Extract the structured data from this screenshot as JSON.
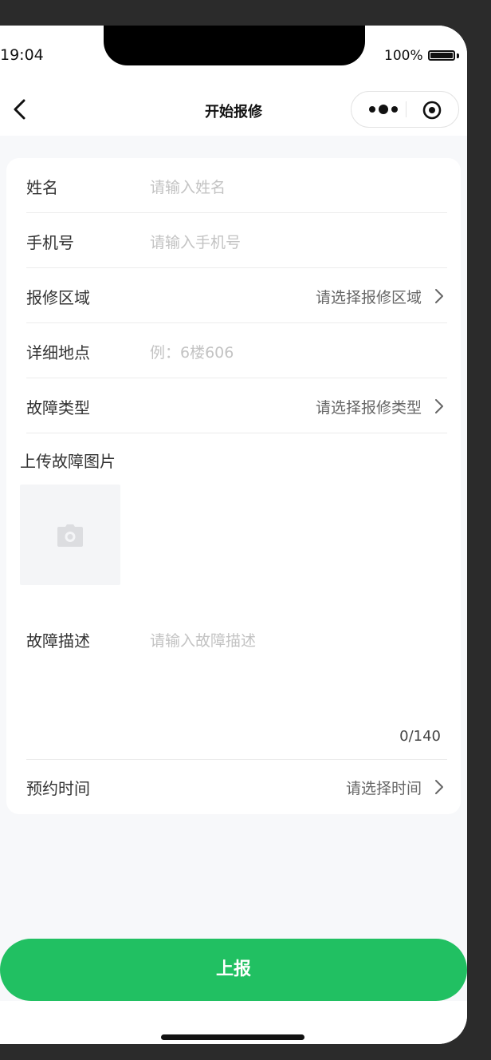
{
  "status_bar": {
    "time": "19:04",
    "battery": "100%"
  },
  "nav": {
    "title": "开始报修"
  },
  "form": {
    "name": {
      "label": "姓名",
      "placeholder": "请输入姓名"
    },
    "phone": {
      "label": "手机号",
      "placeholder": "请输入手机号"
    },
    "area": {
      "label": "报修区域",
      "value": "请选择报修区域"
    },
    "location": {
      "label": "详细地点",
      "placeholder": "例：6楼606"
    },
    "fault_type": {
      "label": "故障类型",
      "value": "请选择报修类型"
    },
    "upload": {
      "label": "上传故障图片"
    },
    "description": {
      "label": "故障描述",
      "placeholder": "请输入故障描述",
      "counter": "0/140"
    },
    "appointment": {
      "label": "预约时间",
      "value": "请选择时间"
    }
  },
  "submit_label": "上报",
  "colors": {
    "accent": "#21c062",
    "background": "#f7f8fa",
    "placeholder": "#c3c3c3"
  },
  "icons": [
    "back-icon",
    "more-icon",
    "target-icon",
    "chevron-right-icon",
    "camera-icon"
  ]
}
